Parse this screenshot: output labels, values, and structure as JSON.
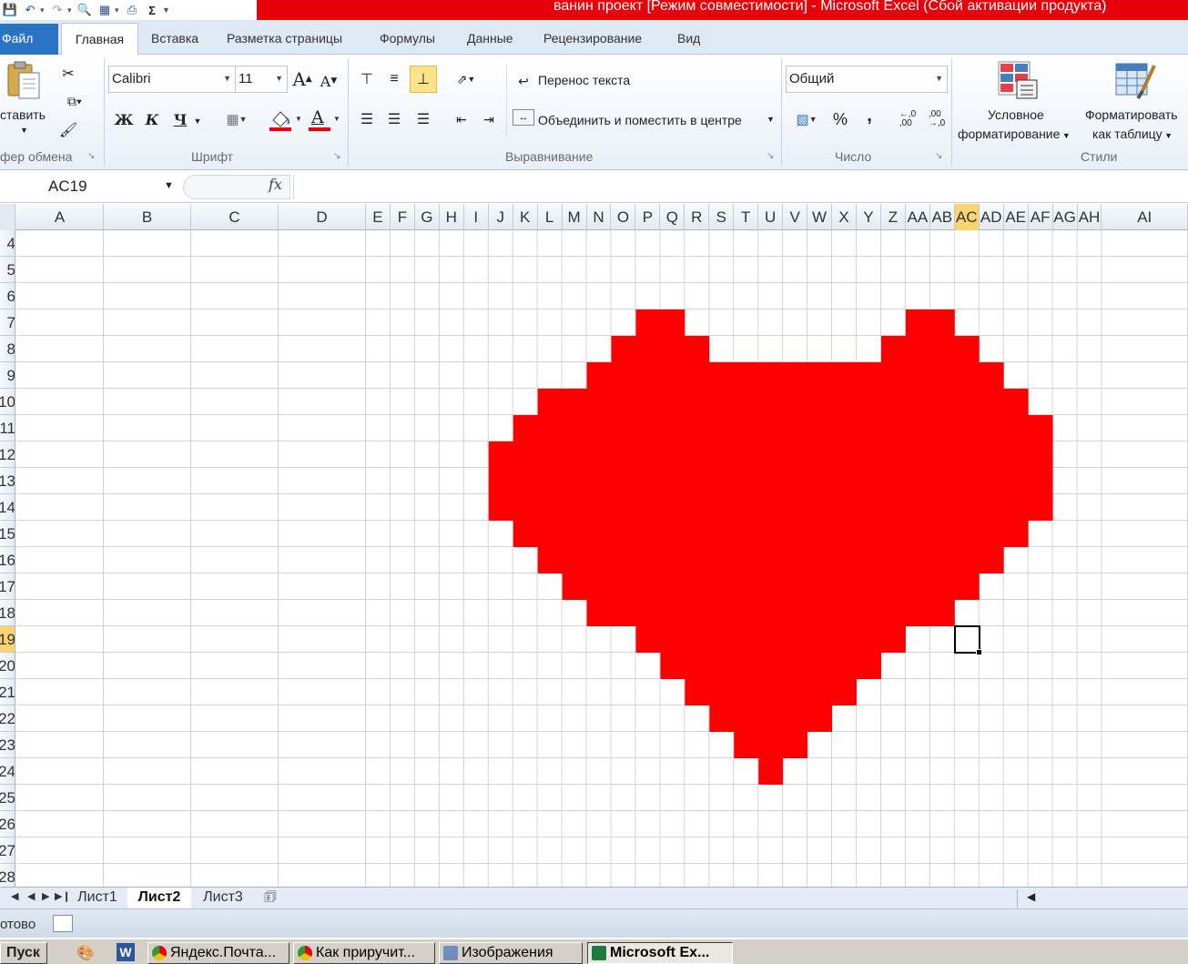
{
  "window": {
    "title": "ванин проект  [Режим совместимости]  -  Microsoft Excel (Сбой активации продукта)"
  },
  "tabs": [
    "Файл",
    "Главная",
    "Вставка",
    "Разметка страницы",
    "Формулы",
    "Данные",
    "Рецензирование",
    "Вид"
  ],
  "ribbon": {
    "clipboard": {
      "paste_label": "Вставить",
      "group_label": "Буфер обмена",
      "visible_label": "фер обмена",
      "visible_paste": "ставить"
    },
    "font": {
      "font_name": "Calibri",
      "font_size": "11",
      "group_label": "Шрифт",
      "bold": "Ж",
      "italic": "К",
      "underline": "Ч",
      "grow": "A",
      "shrink": "A",
      "color_letter": "A"
    },
    "alignment": {
      "wrap_text": "Перенос текста",
      "merge_center": "Объединить и поместить в центре",
      "group_label": "Выравнивание"
    },
    "number": {
      "format": "Общий",
      "group_label": "Число",
      "percent": "%",
      "comma": "‚",
      "inc_decimal": "+,0 ,00",
      "dec_decimal": ",00 →,0"
    },
    "styles": {
      "conditional_line1": "Условное",
      "conditional_line2": "форматирование",
      "table_line1": "Форматировать",
      "table_line2": "как таблицу",
      "group_label": "Стили"
    }
  },
  "formula_bar": {
    "name_box": "AC19",
    "fx": "fx",
    "value": ""
  },
  "columns": [
    "A",
    "B",
    "C",
    "D",
    "E",
    "F",
    "G",
    "H",
    "I",
    "J",
    "K",
    "L",
    "M",
    "N",
    "O",
    "P",
    "Q",
    "R",
    "S",
    "T",
    "U",
    "V",
    "W",
    "X",
    "Y",
    "Z",
    "AA",
    "AB",
    "AC",
    "AD",
    "AE",
    "AF",
    "AG",
    "AH",
    "AI"
  ],
  "rows": [
    "4",
    "5",
    "6",
    "7",
    "8",
    "9",
    "10",
    "11",
    "12",
    "13",
    "14",
    "15",
    "16",
    "17",
    "18",
    "19",
    "20",
    "21",
    "22",
    "23",
    "24",
    "25",
    "26",
    "27",
    "28"
  ],
  "selected_cell": {
    "column": "AC",
    "row": "19"
  },
  "heart": {
    "color": "#ff0000",
    "rows": {
      "7": [
        [
          "P",
          "Q"
        ],
        [
          "AA",
          "AB"
        ]
      ],
      "8": [
        [
          "O",
          "R"
        ],
        [
          "Z",
          "AC"
        ]
      ],
      "9": [
        [
          "N",
          "AD"
        ]
      ],
      "10": [
        [
          "L",
          "AE"
        ]
      ],
      "11": [
        [
          "K",
          "AF"
        ]
      ],
      "12": [
        [
          "J",
          "AF"
        ]
      ],
      "13": [
        [
          "J",
          "AF"
        ]
      ],
      "14": [
        [
          "J",
          "AF"
        ]
      ],
      "15": [
        [
          "K",
          "AE"
        ]
      ],
      "16": [
        [
          "L",
          "AD"
        ]
      ],
      "17": [
        [
          "M",
          "AC"
        ]
      ],
      "18": [
        [
          "N",
          "AB"
        ]
      ],
      "19": [
        [
          "P",
          "Z"
        ]
      ],
      "20": [
        [
          "Q",
          "Y"
        ]
      ],
      "21": [
        [
          "R",
          "X"
        ]
      ],
      "22": [
        [
          "S",
          "W"
        ]
      ],
      "23": [
        [
          "T",
          "V"
        ]
      ],
      "24": [
        [
          "U",
          "U"
        ]
      ]
    }
  },
  "sheet_tabs": [
    "Лист1",
    "Лист2",
    "Лист3"
  ],
  "active_sheet": "Лист2",
  "status": {
    "text": "Готово",
    "visible_text": "отово"
  },
  "taskbar": {
    "start": "Пуск",
    "items": [
      "Яндекс.Почта...",
      "Как приручит...",
      "Изображения",
      "Microsoft Ex..."
    ]
  },
  "colors": {
    "accent": "#2a73c2",
    "title_bar": "#e8000b",
    "selection_header": "#f9d572",
    "heart": "#ff0000"
  }
}
